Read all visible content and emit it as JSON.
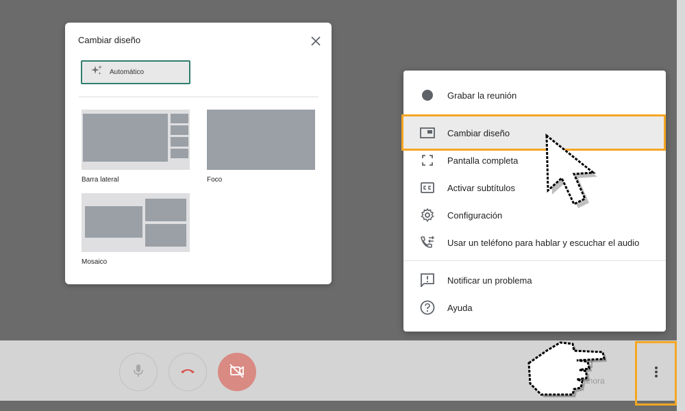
{
  "dialog": {
    "title": "Cambiar diseño",
    "close_icon": "close-icon",
    "auto_option": {
      "label": "Automático",
      "icon": "sparkle-icon"
    },
    "layouts": [
      {
        "label": "Barra lateral"
      },
      {
        "label": "Foco"
      },
      {
        "label": "Mosaico"
      }
    ]
  },
  "menu": {
    "items": [
      {
        "label": "Grabar la reunión",
        "icon": "record-icon"
      },
      {
        "label": "Cambiar diseño",
        "icon": "layout-icon",
        "highlighted": true
      },
      {
        "label": "Pantalla completa",
        "icon": "fullscreen-icon"
      },
      {
        "label": "Activar subtítulos",
        "icon": "captions-icon"
      },
      {
        "label": "Configuración",
        "icon": "gear-icon"
      },
      {
        "label": "Usar un teléfono para hablar y escuchar el audio",
        "icon": "phone-icon"
      },
      {
        "label": "Notificar un problema",
        "icon": "report-icon"
      },
      {
        "label": "Ayuda",
        "icon": "help-icon"
      }
    ]
  },
  "bottom_bar": {
    "present_label": "ar ahora",
    "buttons": [
      "mic-icon",
      "hang-up-icon",
      "camera-off-icon",
      "more-vert-icon"
    ]
  },
  "colors": {
    "highlight": "#f5a623",
    "auto_border": "#2f7d6d",
    "camera_off": "#d98a83",
    "hangup": "#d93025"
  }
}
